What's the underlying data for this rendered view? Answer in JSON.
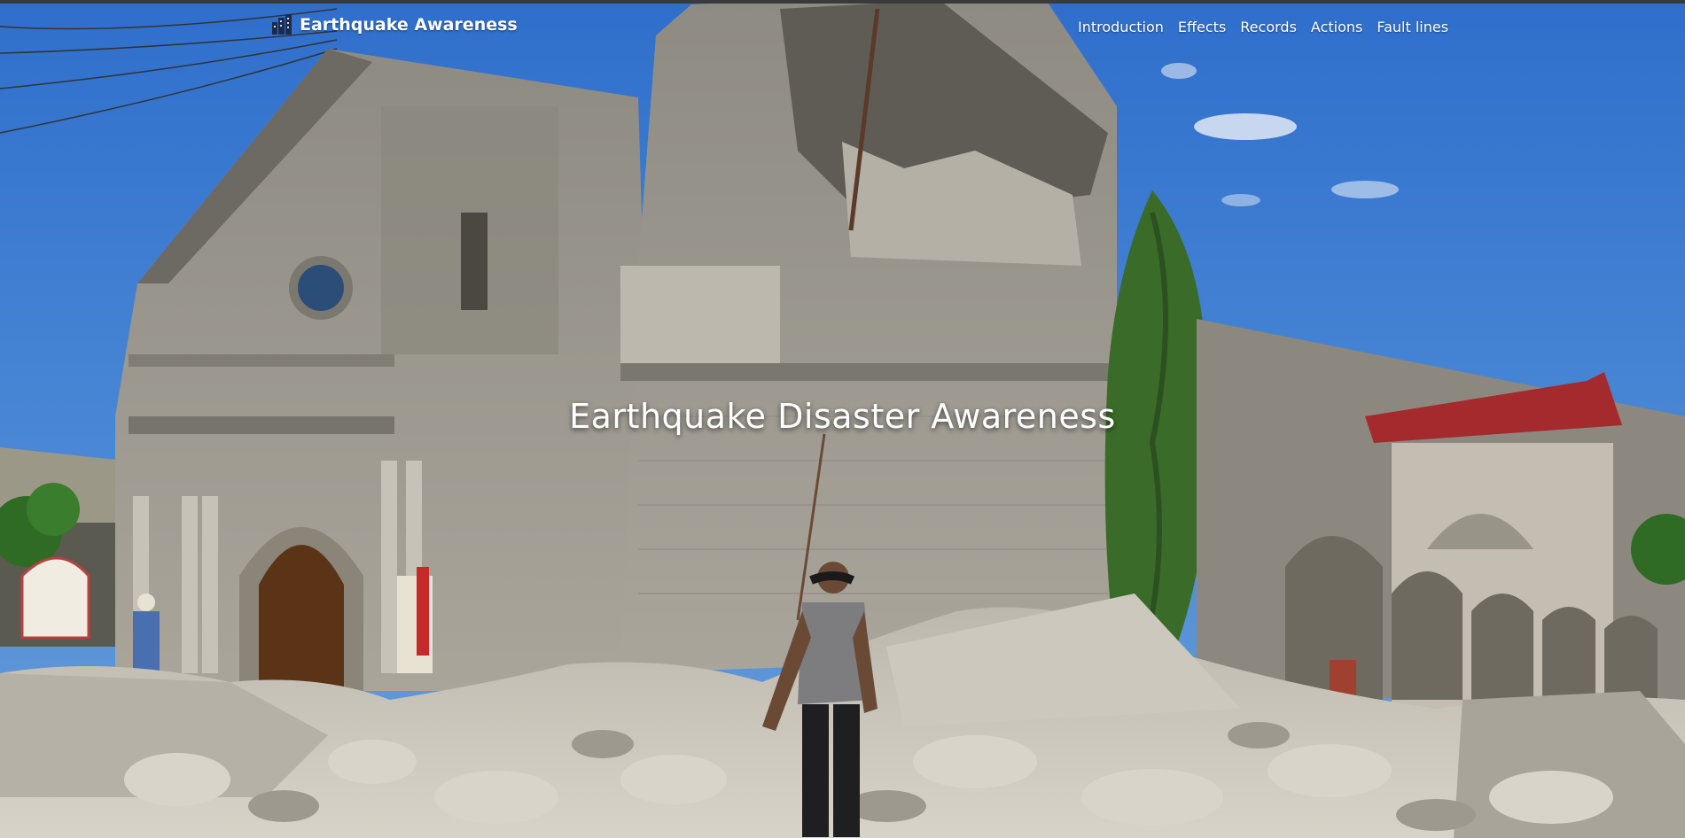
{
  "brand": {
    "name": "Earthquake Awareness",
    "icon": "building-icon"
  },
  "nav": {
    "items": [
      {
        "label": "Introduction"
      },
      {
        "label": "Effects"
      },
      {
        "label": "Records"
      },
      {
        "label": "Actions"
      },
      {
        "label": "Fault lines"
      }
    ]
  },
  "hero": {
    "title": "Earthquake Disaster Awareness",
    "image": "earthquake-damaged-church-photo"
  },
  "colors": {
    "sky": "#3b7bd0",
    "stone": "#a8a49a",
    "rubble": "#cfcac0",
    "roof": "#b52a2e",
    "text": "#ffffff"
  }
}
